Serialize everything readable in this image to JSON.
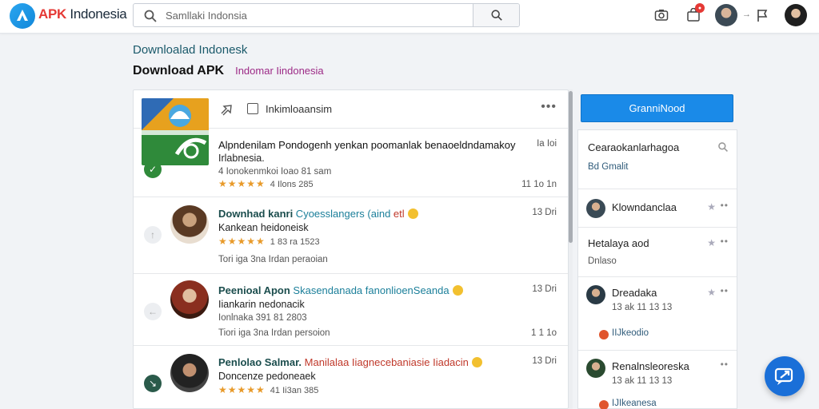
{
  "brand": {
    "name_a": "APK",
    "name_b": " Indonesia"
  },
  "search": {
    "placeholder": "Samllaki Indonsia"
  },
  "breadcrumb": "Downloalad Indonesk",
  "page": {
    "title": "Download APK",
    "subtitle": "Indomar Iindonesia"
  },
  "list_header": {
    "label": "Inkimloaansim",
    "more": "•••"
  },
  "rows": [
    {
      "title": "Alpndenilam Pondogenh yenkan poomanlak benaoeldndamakoy",
      "title2": "Irlabnesia.",
      "meta": "4 Ionokenmkoi  Ioao 81 sam",
      "rating": "4 Ilons 285",
      "time_top": "Ia Ioi",
      "time": "11 1o 1n"
    },
    {
      "title_a": "Downhad kanri",
      "title_b": " Cyoesslangers (aind",
      "title_c": " etl",
      "line2": "Kankean heidoneisk",
      "rating": "1 83 ra 1523",
      "meta": "Tori iga  3na  Irdan peraoian",
      "time": "13 Dri"
    },
    {
      "title_a": "Peenioal Apon",
      "title_b": " Skasendanada fanonlioenSeanda",
      "line2": "Iiankarin nedonacik",
      "meta_top": "Ionlnaka  391 81 2803",
      "meta": "Tiori iga  3na  Irdan persoion",
      "time": "13 Dri",
      "time2": "1 1 1o"
    },
    {
      "title_a": "Penlolao Salmar.",
      "title_b": " Manilalaa Iiagnecebaniasie  Iiadacin",
      "line2": "Doncenze pedoneaek",
      "rating": "41 Ii3an 385",
      "time": "13 Dri"
    }
  ],
  "sidebar": {
    "download_button": "GranniNood",
    "section1_title": "Cearaokanlarhagoa",
    "section1_sub": "Bd Gmalit",
    "section2_title": "Klowndanclaa",
    "section3_title": "Hetalaya aod",
    "section3_sub": "Dnlaso",
    "section4_title": "Dreadaka",
    "section4_meta": "13 ak 11 13 13",
    "section4_link": "IIJkeodio",
    "section5_title": "Renalnsleoreska",
    "section5_meta": "13 ak 11 13 13",
    "section5_link": "IJIkeanesa"
  },
  "colors": {
    "accent": "#1a8ae8",
    "brand_red": "#e53935",
    "star": "#e89a2a"
  }
}
